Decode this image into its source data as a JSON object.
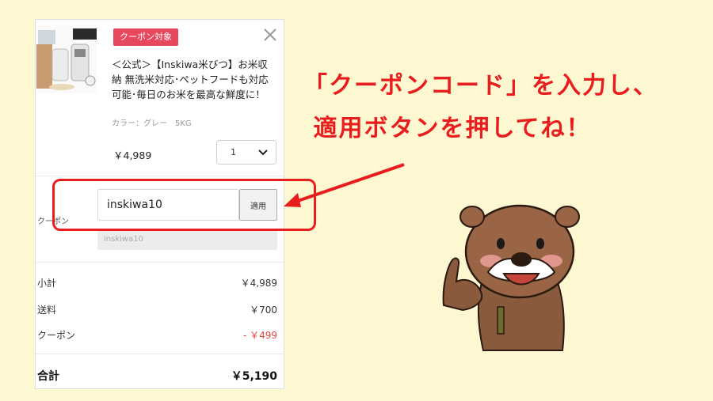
{
  "cart": {
    "badge": "クーポン対象",
    "product_name": "＜公式＞【Inskiwa米びつ】お米収納 無洗米対応･ペットフードも対応可能･毎日のお米を最高な鮮度に！",
    "variant": "カラー：グレー　5KG",
    "price": "￥4,989",
    "quantity": "1",
    "coupon_label": "クーポン",
    "coupon_value": "inskiwa10",
    "apply_label": "適用",
    "coupon_hint": "inskiwa10",
    "summary": [
      {
        "label": "小計",
        "value": "￥4,989"
      },
      {
        "label": "送料",
        "value": "￥700"
      },
      {
        "label": "クーポン",
        "value": "- ￥499"
      }
    ],
    "total_label": "合計",
    "total_value": "￥5,190"
  },
  "annotation": {
    "text": "「クーポンコード」を入力し、\n 適用ボタンを押してね！"
  },
  "colors": {
    "badge": "#e8485e",
    "highlight": "#e81e1e",
    "discount": "#e0483e",
    "background": "#fdf8d2"
  },
  "icons": [
    "close-icon",
    "chevron-down-icon",
    "product-thumbnail",
    "otter-illustration",
    "pointer-arrow"
  ]
}
